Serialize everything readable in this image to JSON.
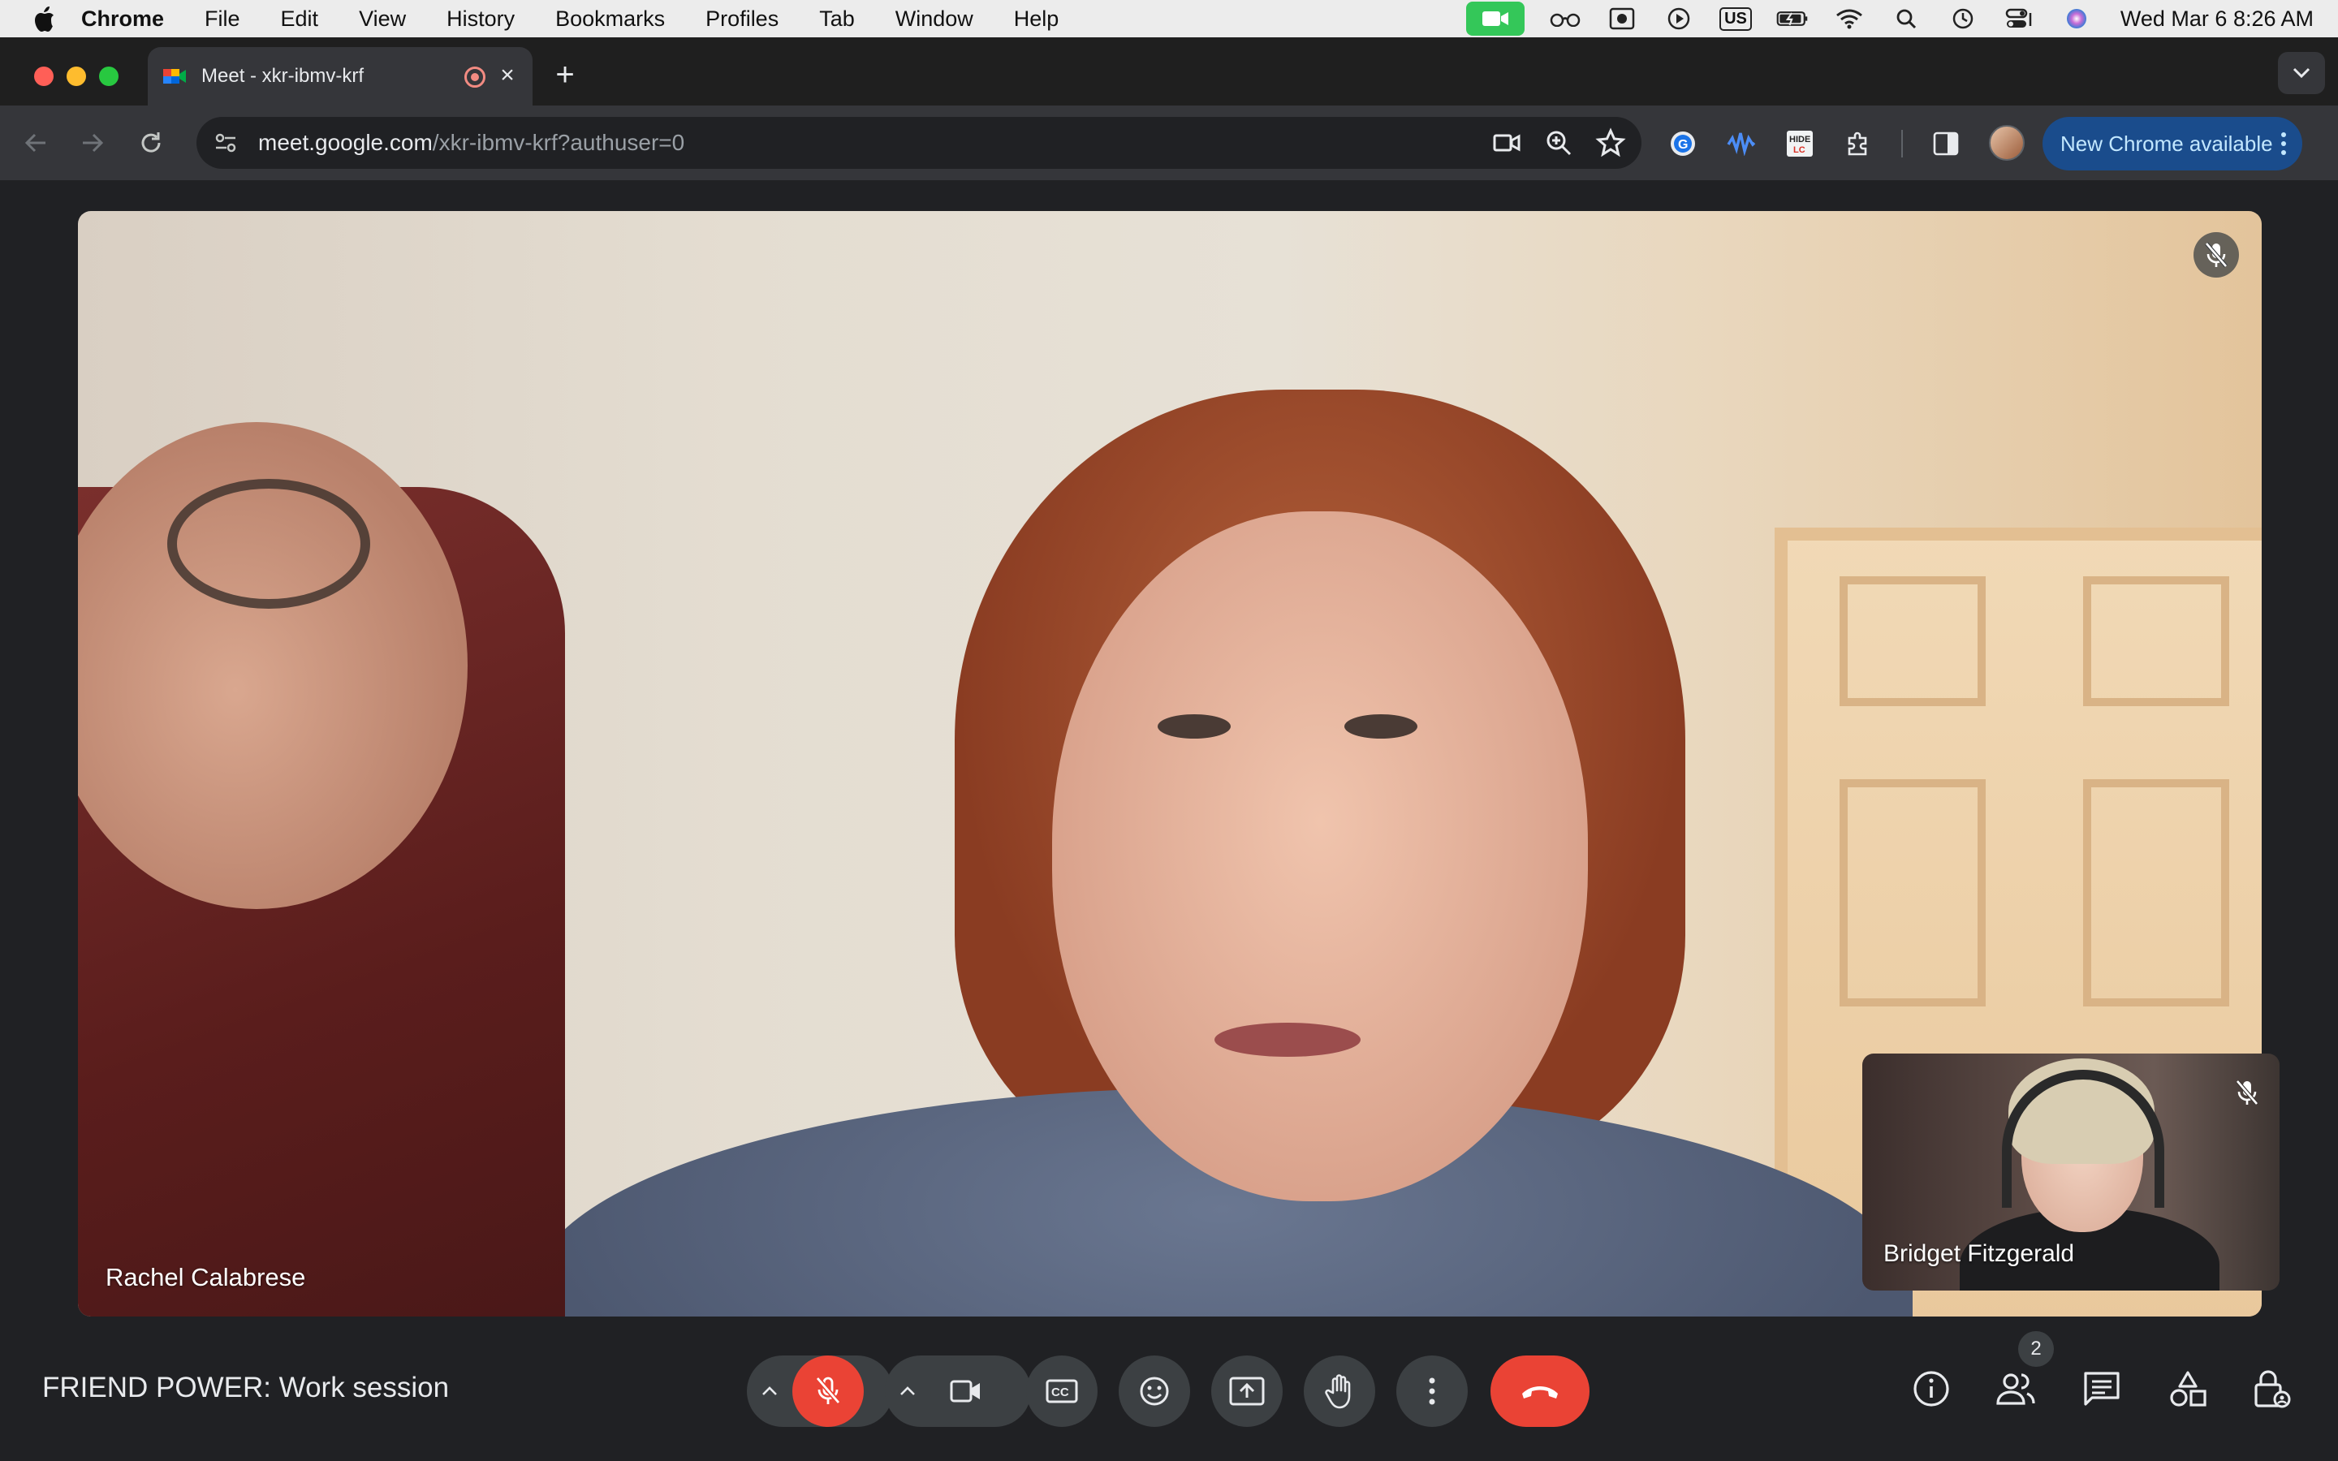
{
  "menubar": {
    "app_name": "Chrome",
    "items": [
      "File",
      "Edit",
      "View",
      "History",
      "Bookmarks",
      "Profiles",
      "Tab",
      "Window",
      "Help"
    ],
    "keyboard_layout": "US",
    "clock": "Wed Mar 6  8:26 AM",
    "status_icons": [
      "meet-camera-indicator",
      "glasses-icon",
      "screen-record-icon",
      "play-icon",
      "keyboard-layout",
      "battery-icon",
      "wifi-icon",
      "search-icon",
      "history-icon",
      "control-center-icon",
      "siri-icon"
    ]
  },
  "browser": {
    "tab": {
      "title": "Meet - xkr-ibmv-krf",
      "recording": true
    },
    "new_tab_label": "+",
    "url": {
      "host": "meet.google.com",
      "path": "/xkr-ibmv-krf?authuser=0"
    },
    "update_button": "New Chrome available",
    "colors": {
      "accent": "#1a4c8c",
      "tab_bg": "#35363a",
      "frame_bg": "#1f1f1f"
    }
  },
  "meet": {
    "main_participant": {
      "name": "Rachel Calabrese",
      "muted": true
    },
    "self_participant": {
      "name": "Bridget Fitzgerald",
      "muted": true
    },
    "meeting_title": "FRIEND POWER: Work session",
    "participant_count": "2",
    "controls": {
      "mic": {
        "state": "off",
        "icon": "mic-off-icon"
      },
      "camera": {
        "state": "on",
        "icon": "camera-icon"
      },
      "captions": "closed-captions-icon",
      "reactions": "emoji-icon",
      "present": "present-screen-icon",
      "raise_hand": "hand-icon",
      "more": "more-options-icon",
      "leave": "end-call-icon"
    },
    "side_controls": [
      "info-icon",
      "people-icon",
      "chat-icon",
      "activities-icon",
      "host-controls-icon"
    ],
    "colors": {
      "end_call": "#ea4335",
      "mic_off": "#ea4335",
      "control_bg": "#3c4043",
      "stage_bg": "#202124"
    }
  }
}
